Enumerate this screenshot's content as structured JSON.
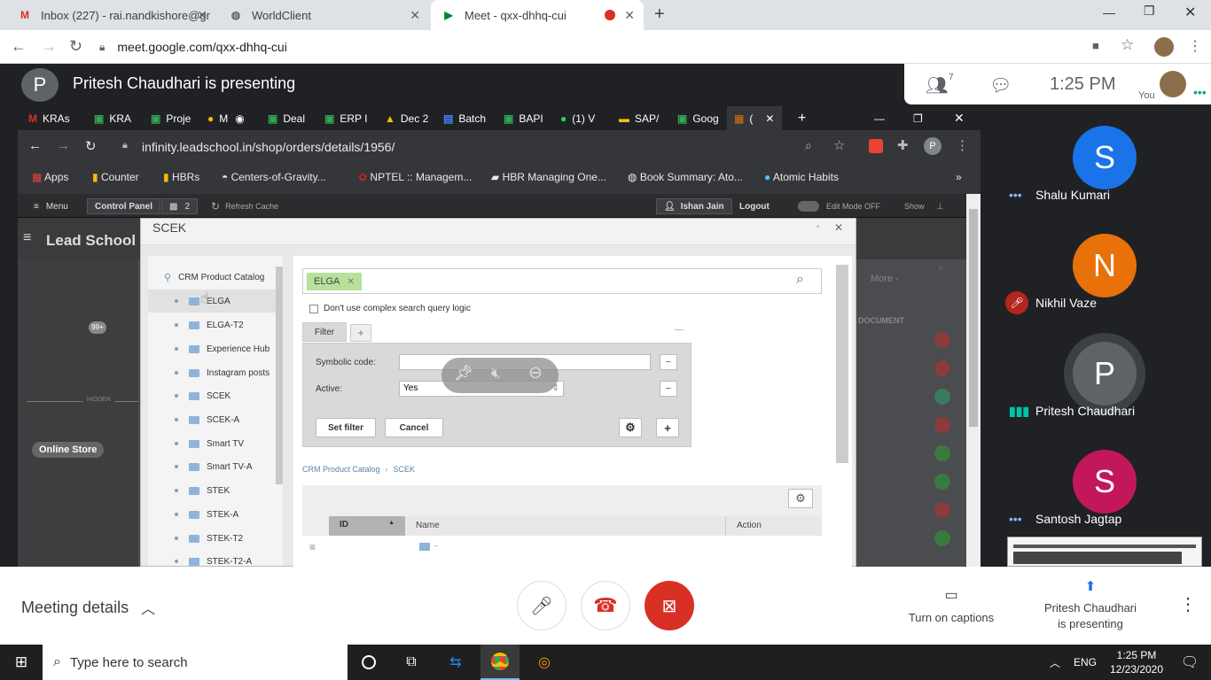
{
  "browser_tabs": [
    {
      "title": "Inbox (227) - rai.nandkishore@gr",
      "icon": "gmail-icon"
    },
    {
      "title": "WorldClient",
      "icon": "globe-icon"
    },
    {
      "title": "Meet - qxx-dhhq-cui",
      "icon": "meet-icon",
      "active": true
    }
  ],
  "address_bar": {
    "url": "meet.google.com/qxx-dhhq-cui"
  },
  "presenting_banner": {
    "avatar_letter": "P",
    "text": "Pritesh Chaudhari is presenting"
  },
  "meet_header": {
    "participant_count": "7",
    "time": "1:25 PM",
    "you_label": "You"
  },
  "shared_screen": {
    "tabs": [
      "KRAs",
      "KRA",
      "Proje",
      "M",
      "Deal",
      "ERP I",
      "Dec 2",
      "Batch",
      "BAPI",
      "(1) V",
      "SAP/",
      "Goog",
      "("
    ],
    "url": "infinity.leadschool.in/shop/orders/details/1956/",
    "profile_letter": "P",
    "bookmarks": [
      "Apps",
      "Counter",
      "HBRs",
      "Centers-of-Gravity...",
      "NPTEL :: Managem...",
      "HBR Managing One...",
      "Book Summary: Ato...",
      "Atomic Habits"
    ],
    "cms_bar": {
      "menu": "Menu",
      "control_panel": "Control Panel",
      "notif_count": "2",
      "refresh": "Refresh Cache",
      "user": "Ishan Jain",
      "logout": "Logout",
      "edit_mode": "Edit Mode",
      "edit_mode_state": "OFF",
      "show": "Show"
    },
    "site_title": "Lead School",
    "side_badge": "99+",
    "side_hidden": "HIDDEN",
    "online_store": "Online Store",
    "bg_more": "More -",
    "bg_document": "DOCUMENT",
    "dialog": {
      "title": "SCEK",
      "tree_root": "CRM Product Catalog",
      "tree_items": [
        "ELGA",
        "ELGA-T2",
        "Experience Hub",
        "Instagram posts",
        "SCEK",
        "SCEK-A",
        "Smart TV",
        "Smart TV-A",
        "STEK",
        "STEK-A",
        "STEK-T2",
        "STEK-T2-A"
      ],
      "search_tag": "ELGA",
      "complex_query_label": "Don't use complex search query logic",
      "filter_tab": "Filter",
      "symbolic_code_label": "Symbolic code:",
      "symbolic_code_value": "",
      "active_label": "Active:",
      "active_value": "Yes",
      "set_filter": "Set filter",
      "cancel": "Cancel",
      "breadcrumb": [
        "CRM Product Catalog",
        "SCEK"
      ],
      "columns": [
        "ID",
        "Name",
        "Action"
      ],
      "row_name": ".."
    }
  },
  "participants": [
    {
      "letter": "S",
      "name": "Shalu Kumari",
      "color": "#1a73e8",
      "status": "more-icon"
    },
    {
      "letter": "N",
      "name": "Nikhil Vaze",
      "color": "#e8710a",
      "status": "muted-mic-icon"
    },
    {
      "letter": "P",
      "name": "Pritesh Chaudhari",
      "color": "#5f6368",
      "status": "speaking-icon"
    },
    {
      "letter": "S",
      "name": "Santosh Jagtap",
      "color": "#c2185b",
      "status": "more-icon"
    }
  ],
  "meet_bottom": {
    "meeting_details": "Meeting details",
    "captions": "Turn on captions",
    "presenting": "Pritesh Chaudhari",
    "presenting_line2": "is presenting"
  },
  "taskbar": {
    "search_placeholder": "Type here to search",
    "lang": "ENG",
    "time": "1:25 PM",
    "date": "12/23/2020"
  }
}
